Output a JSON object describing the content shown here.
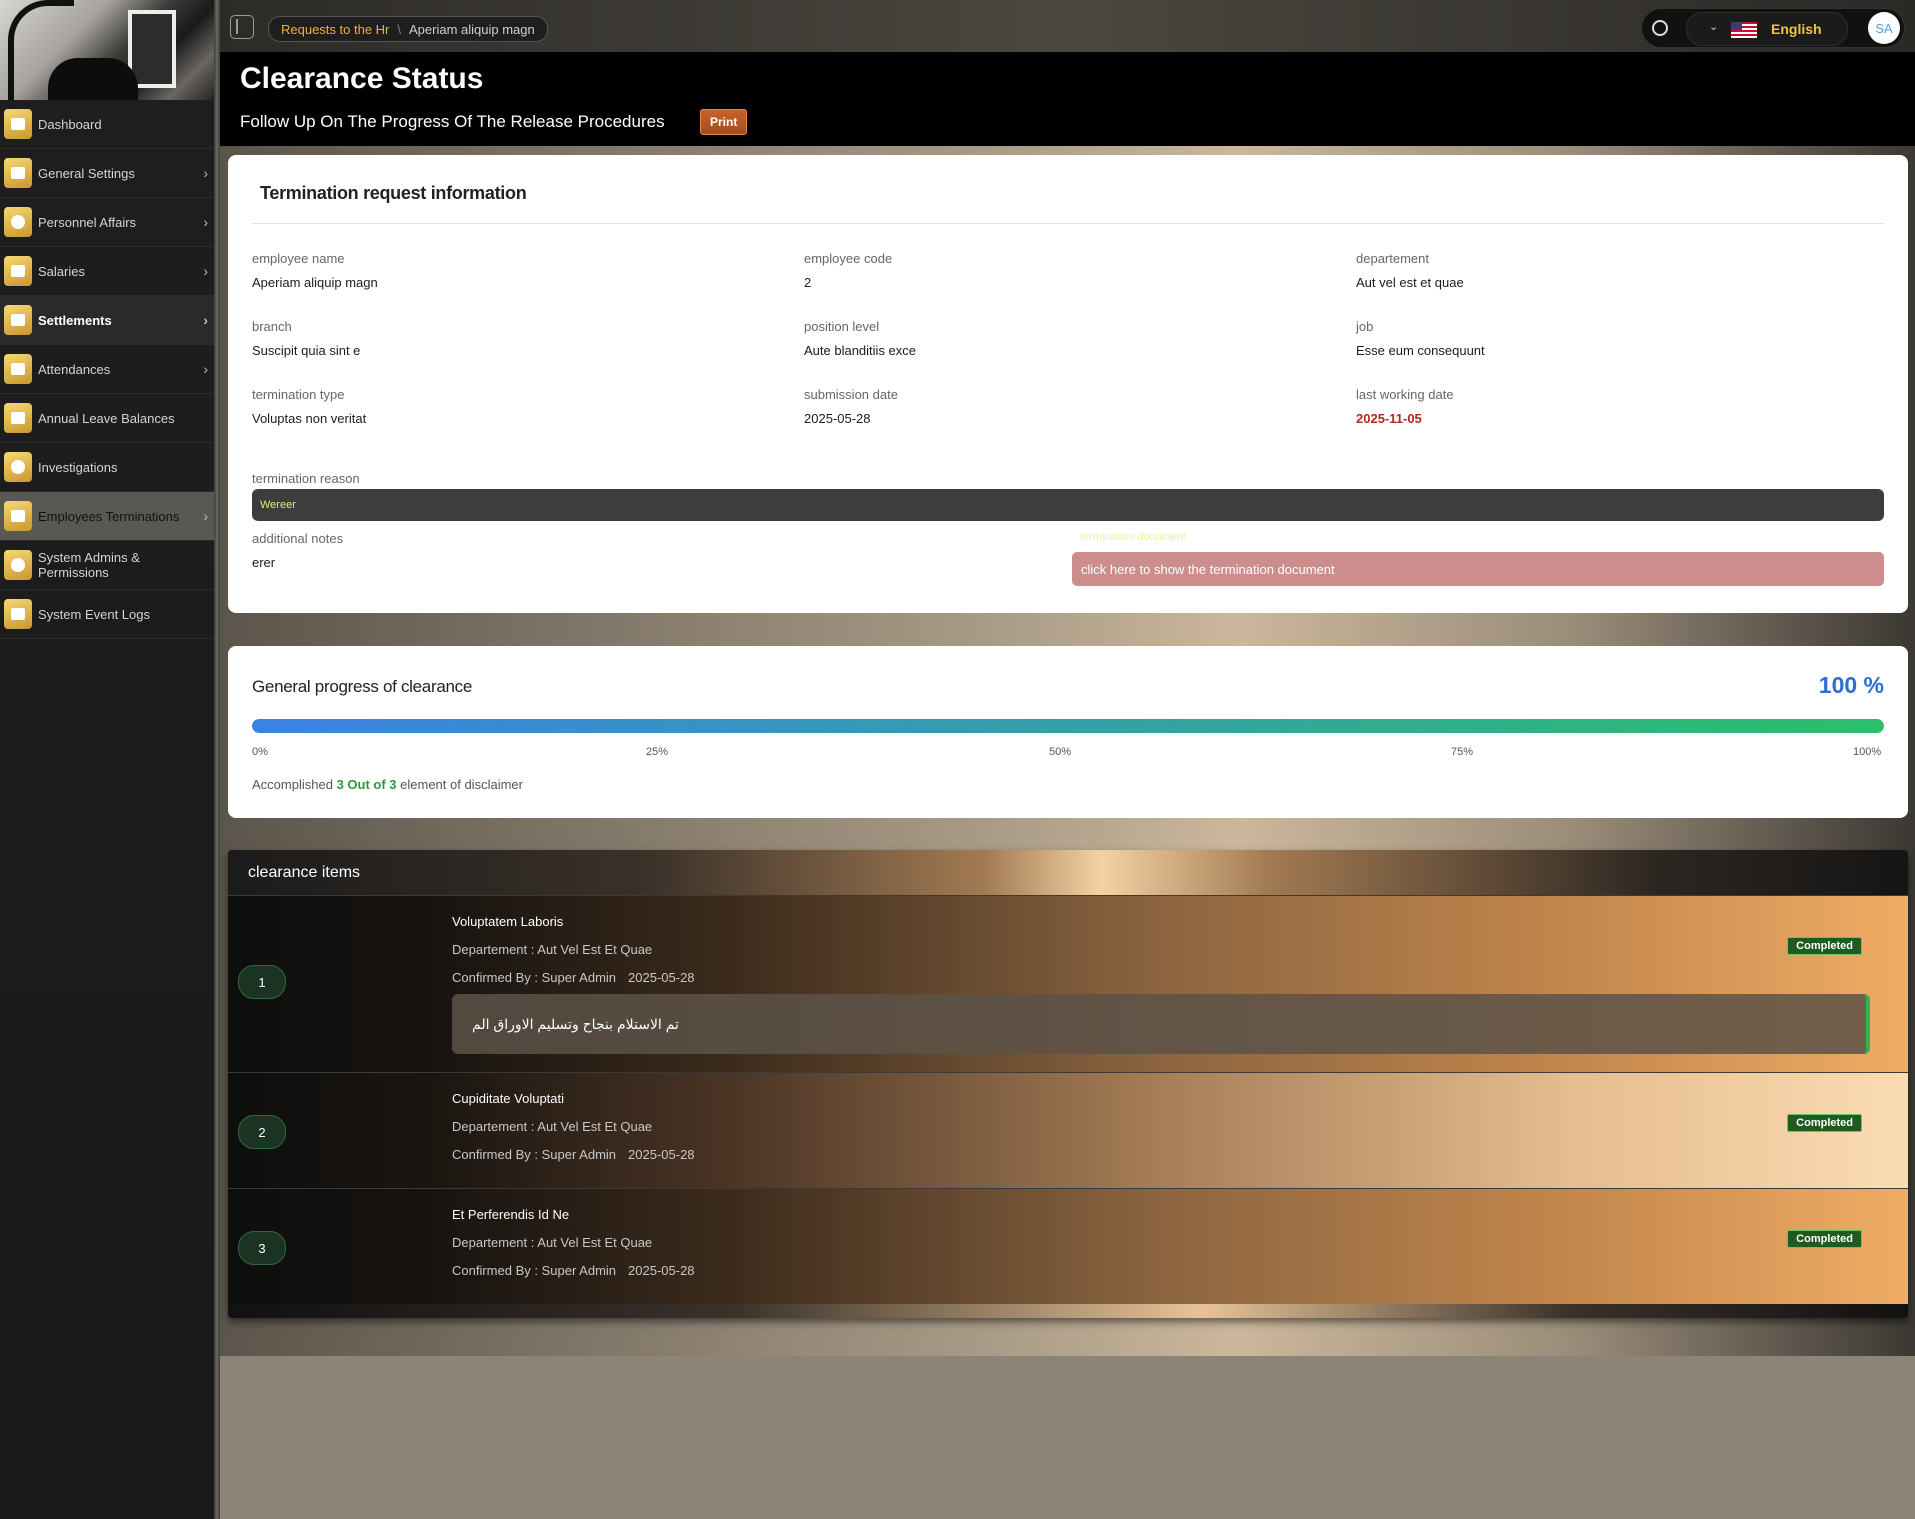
{
  "sidebar": {
    "items": [
      {
        "label": "Dashboard",
        "icon": "home-icon",
        "chevron": false
      },
      {
        "label": "General Settings",
        "icon": "sliders-icon",
        "chevron": true
      },
      {
        "label": "Personnel Affairs",
        "icon": "users-icon",
        "chevron": true
      },
      {
        "label": "Salaries",
        "icon": "chart-icon",
        "chevron": true
      },
      {
        "label": "Settlements",
        "icon": "list-icon",
        "chevron": true
      },
      {
        "label": "Attendances",
        "icon": "briefcase-icon",
        "chevron": true
      },
      {
        "label": "Annual Leave Balances",
        "icon": "bag-icon",
        "chevron": false
      },
      {
        "label": "Investigations",
        "icon": "circle-icon",
        "chevron": false
      },
      {
        "label": "Employees Terminations",
        "icon": "copy-icon",
        "chevron": true
      },
      {
        "label": "System Admins & Permissions",
        "icon": "shield-icon",
        "chevron": false
      },
      {
        "label": "System Event Logs",
        "icon": "list-icon",
        "chevron": false
      }
    ]
  },
  "topbar": {
    "breadcrumb": {
      "parent": "Requests to the Hr",
      "separator": "\\",
      "current": "Aperiam aliquip magn"
    },
    "language": "English",
    "avatar_initials": "SA"
  },
  "header": {
    "title": "Clearance Status",
    "subtitle": "Follow Up On The Progress Of The Release Procedures",
    "print_label": "Print"
  },
  "info": {
    "title": "Termination request information",
    "employee_name": {
      "label": "employee name",
      "value": "Aperiam aliquip magn"
    },
    "employee_code": {
      "label": "employee code",
      "value": "2"
    },
    "department": {
      "label": "departement",
      "value": "Aut vel est et quae"
    },
    "branch": {
      "label": "branch",
      "value": "Suscipit quia sint e"
    },
    "position_level": {
      "label": "position level",
      "value": "Aute blanditiis exce"
    },
    "job": {
      "label": "job",
      "value": "Esse eum consequunt"
    },
    "termination_type": {
      "label": "termination type",
      "value": "Voluptas non veritat"
    },
    "submission_date": {
      "label": "submission date",
      "value": "2025-05-28"
    },
    "last_working_date": {
      "label": "last working date",
      "value": "2025-11-05"
    },
    "termination_reason": {
      "label": "termination reason",
      "value": "Wereer"
    },
    "additional_notes": {
      "label": "additional notes",
      "value": "erer"
    },
    "document_hint": "termination document",
    "document_button": "click here to show the termination document"
  },
  "progress": {
    "title": "General progress of clearance",
    "percent_label": "100 %",
    "percent": 100,
    "ticks": [
      "0%",
      "25%",
      "50%",
      "75%",
      "100%"
    ],
    "summary_prefix": "Accomplished",
    "summary_highlight": "3 Out of 3",
    "summary_suffix": "element of disclaimer"
  },
  "clearance": {
    "title": "clearance items",
    "items": [
      {
        "number": "1",
        "name": "Voluptatem Laboris",
        "department": "Departement : Aut Vel Est Et Quae",
        "confirmed_by": "Confirmed By : Super Admin",
        "date": "2025-05-28",
        "status": "Completed",
        "note": "تم الاستلام بنجاح وتسليم الاوراق الم"
      },
      {
        "number": "2",
        "name": "Cupiditate Voluptati",
        "department": "Departement : Aut Vel Est Et Quae",
        "confirmed_by": "Confirmed By : Super Admin",
        "date": "2025-05-28",
        "status": "Completed"
      },
      {
        "number": "3",
        "name": "Et Perferendis Id Ne",
        "department": "Departement : Aut Vel Est Et Quae",
        "confirmed_by": "Confirmed By : Super Admin",
        "date": "2025-05-28",
        "status": "Completed"
      }
    ]
  },
  "colors": {
    "accent_gold": "#e8b43c",
    "progress_blue": "#2a6fd1",
    "completed_green": "#1f5b1f",
    "date_red": "#b22a1a"
  }
}
